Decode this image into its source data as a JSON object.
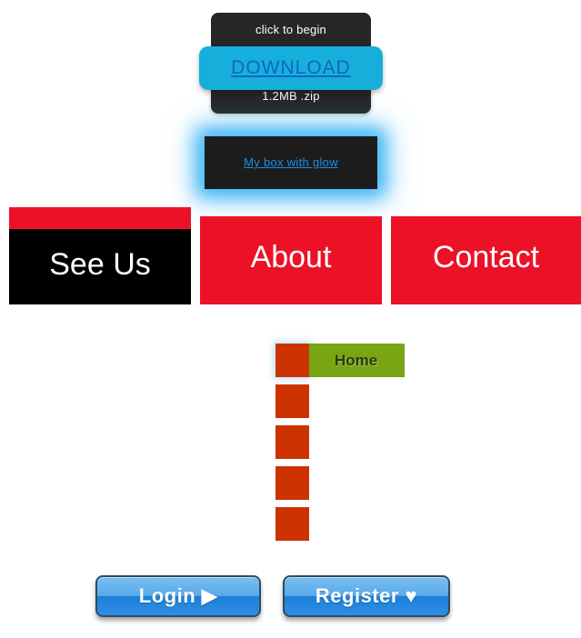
{
  "download_widget": {
    "top_label": "click to begin",
    "link_label": "DOWNLOAD",
    "bottom_label": "1.2MB .zip",
    "bar_color": "#16afdb",
    "box_color": "#262626",
    "link_color": "#1565c0"
  },
  "glow_box": {
    "link_label": "My box with glow",
    "glow_color": "#3db5f5",
    "background_color": "#1c1c1c",
    "link_color": "#1e8fe0"
  },
  "panels": [
    {
      "label": "See Us",
      "background_color": "#000000",
      "accent_color": "#ec1127"
    },
    {
      "label": "About",
      "background_color": "#ec1127"
    },
    {
      "label": "Contact",
      "background_color": "#ec1127"
    }
  ],
  "square_menu": {
    "bullet_color": "#cc3300",
    "active_color": "#79a414",
    "items": [
      {
        "label": "Home",
        "active": true
      },
      {
        "label": "",
        "active": false
      },
      {
        "label": "",
        "active": false
      },
      {
        "label": "",
        "active": false
      },
      {
        "label": "",
        "active": false
      }
    ]
  },
  "buttons": [
    {
      "label": "Login ▶",
      "name": "login-button"
    },
    {
      "label": "Register ♥",
      "name": "register-button"
    }
  ]
}
